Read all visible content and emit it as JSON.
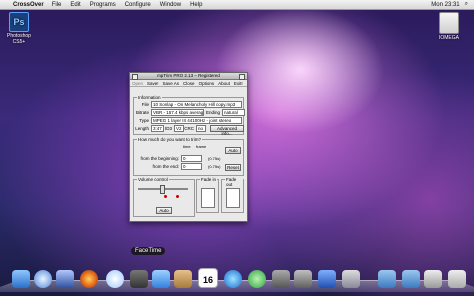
{
  "menubar": {
    "app": "CrossOver",
    "items": [
      "File",
      "Edit",
      "Programs",
      "Configure",
      "Window",
      "Help"
    ],
    "clock": "Mon 23:31"
  },
  "desktop": {
    "photoshop_icon_text": "Ps",
    "photoshop_label": "Photoshop CS5+",
    "drive_label": "IOMEGA"
  },
  "window": {
    "title": "mpTrim PRO 2.13 – Registered",
    "menu": [
      "Open",
      "Save!",
      "Save As",
      "Close",
      "Options",
      "About",
      "Exit!"
    ],
    "info": {
      "label": "Information",
      "file_label": "File",
      "file": "10 Sonlap - On Melancholy Hill copy.mp3",
      "bitrate_label": "Bitrate",
      "bitrate": "VBR - 157.4 kbps average",
      "ending_label": "Ending",
      "ending": "natural",
      "type_label": "Type",
      "type": "MPEG 1 layer III 44100Hz - joint stereo",
      "length_label": "Length",
      "length": "3:47",
      "id3_label": "ID3",
      "id3": "V2",
      "crc_label": "CRC",
      "crc": "no",
      "advanced": "Advanced info..."
    },
    "trim": {
      "label": "How much do you want to trim?",
      "time_col": "time",
      "frame_col": "frame",
      "begin_label": "from the beginning:",
      "begin_frame": "0",
      "begin_time": "(0.75s)",
      "end_label": "from the end:",
      "end_frame": "0",
      "end_time": "(0.75s)",
      "auto": "Auto",
      "reset": "Reset"
    },
    "volume": {
      "label": "Volume control",
      "fade_in": "Fade in",
      "fade_out": "Fade out",
      "auto": "Auto"
    }
  },
  "dock": {
    "tooltip": "FaceTime",
    "calendar_day": "16"
  }
}
